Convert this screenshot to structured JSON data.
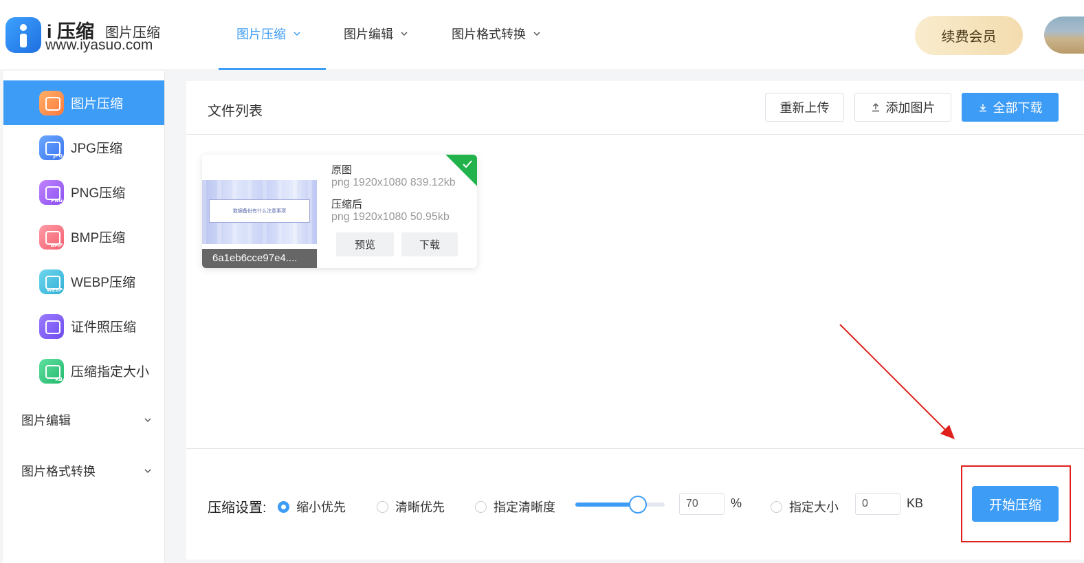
{
  "brand": {
    "name": "i 压缩",
    "tagline": "图片压缩",
    "url": "www.iyasuo.com"
  },
  "nav": {
    "items": [
      {
        "label": "图片压缩"
      },
      {
        "label": "图片编辑"
      },
      {
        "label": "图片格式转换"
      }
    ],
    "vip_button": "续费会员"
  },
  "sidebar": {
    "items": [
      {
        "label": "图片压缩",
        "icon": "image-compress-icon"
      },
      {
        "label": "JPG压缩",
        "icon": "jpg-icon",
        "badge": "JPG"
      },
      {
        "label": "PNG压缩",
        "icon": "png-icon",
        "badge": "PNG"
      },
      {
        "label": "BMP压缩",
        "icon": "bmp-icon",
        "badge": "BMP"
      },
      {
        "label": "WEBP压缩",
        "icon": "webp-icon",
        "badge": "WEBP"
      },
      {
        "label": "证件照压缩",
        "icon": "id-photo-icon"
      },
      {
        "label": "压缩指定大小",
        "icon": "kb-size-icon",
        "badge": "KB"
      }
    ],
    "groups": [
      {
        "label": "图片编辑"
      },
      {
        "label": "图片格式转换"
      }
    ]
  },
  "file_list": {
    "title": "文件列表",
    "reupload": "重新上传",
    "add_image": "添加图片",
    "download_all": "全部下载"
  },
  "file_card": {
    "thumb_text": "数据备份有什么注意事项",
    "filename": "6a1eb6cce97e4....",
    "original_label": "原图",
    "original_meta": "png  1920x1080  839.12kb",
    "compressed_label": "压缩后",
    "compressed_meta": "png  1920x1080  50.95kb",
    "preview": "预览",
    "download": "下载"
  },
  "settings": {
    "label": "压缩设置:",
    "options": [
      {
        "label": "缩小优先",
        "selected": true
      },
      {
        "label": "清晰优先",
        "selected": false
      },
      {
        "label": "指定清晰度",
        "selected": false
      },
      {
        "label": "指定大小",
        "selected": false
      }
    ],
    "quality_value": "70",
    "quality_percent": 70,
    "quality_unit": "%",
    "size_value": "0",
    "size_unit": "KB",
    "start_button": "开始压缩"
  },
  "colors": {
    "accent": "#3d9cf5",
    "success": "#22b24c",
    "annotation": "#e0201c"
  }
}
